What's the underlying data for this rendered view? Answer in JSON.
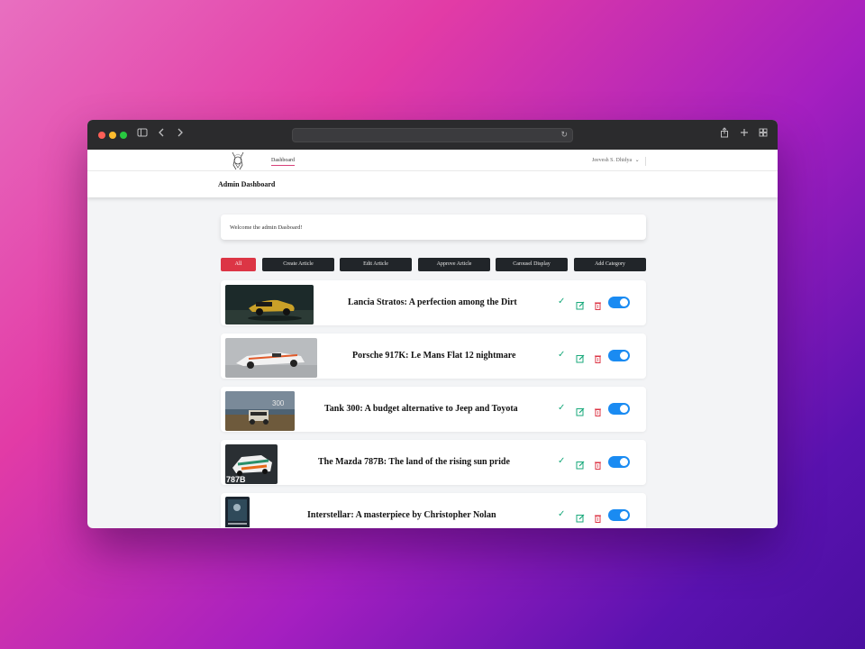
{
  "browser": {
    "url": "",
    "icons": [
      "sidebar-icon",
      "back-icon",
      "forward-icon",
      "share-icon",
      "new-tab-icon",
      "tab-overview-icon"
    ]
  },
  "nav": {
    "dashboard_link": "Dashboard",
    "user_name": "Jeevesh S. Dhidya",
    "user_caret": "⌄"
  },
  "header": {
    "title": "Admin Dashboard"
  },
  "welcome": {
    "text": "Welcome the admin Dasboard!"
  },
  "toolbar": {
    "active_label": "All",
    "buttons": [
      "Create Article",
      "Edit Article",
      "Approve Article",
      "Carousel Display",
      "Add Category"
    ]
  },
  "articles": [
    {
      "title": "Lancia Stratos: A perfection among the Dirt",
      "published": true
    },
    {
      "title": "Porsche 917K: Le Mans Flat 12 nightmare",
      "published": true
    },
    {
      "title": "Tank 300: A budget alternative to Jeep and Toyota",
      "published": true
    },
    {
      "title": "The Mazda 787B: The land of the rising sun pride",
      "published": true
    },
    {
      "title": "Interstellar: A masterpiece by Christopher Nolan",
      "published": true
    }
  ],
  "thumb_text": {
    "tank": "300",
    "mazda": "787B"
  },
  "colors": {
    "accent_red": "#dc3545",
    "toggle_blue": "#1a8bf2",
    "check_green": "#19a97b",
    "dark_button": "#212529"
  }
}
